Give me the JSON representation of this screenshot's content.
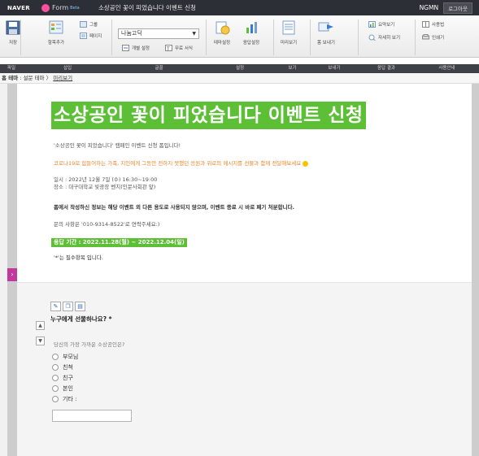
{
  "topbar": {
    "brand": "NAVER",
    "product": "Form",
    "product_badge": "Beta",
    "title": "소상공인 꽃이 피었습니다 이벤트 신청",
    "user_id": "NGMN",
    "logout_label": "로그아웃"
  },
  "ribbon": {
    "save": "저장",
    "add_item": "항목추가",
    "group": "그룹",
    "page": "페이지",
    "font_name": "나눔고딕",
    "open_settings": "개별 설정",
    "copy_format": "무료 서식",
    "design_settings": "테마설정",
    "response_settings": "응답설정",
    "preview": "미리보기",
    "send": "폼 보내기",
    "summary_view": "요약보기",
    "detail_view": "자세히 보기",
    "usage_guide": "사용법",
    "print": "인쇄기"
  },
  "groups": [
    "파일",
    "삽입",
    "글꼴",
    "설정",
    "보기",
    "보내기",
    "응답 결과",
    "사용안내"
  ],
  "breadcrumb": {
    "home": "홈 테마",
    "section": "설문 테마",
    "current": "미리보기"
  },
  "survey": {
    "title": "소상공인 꽃이 피었습니다 이벤트 신청",
    "line1": "'소상공인 꽃이 피었습니다' 캠페인 이벤트 신청 폼입니다!",
    "line2": "코로나19로 힘들어하는 가족, 지인에게 그동안 전하지 못했던 응원과 위로의 메시지를 선물과 함께 전달해보세요",
    "line3": "일시 : 2022년 12월 7일 (수) 16:30~19:00",
    "line4": "장소 : 대구대학교 빛광장 벤치(인문사회관 앞)",
    "line5": "폼에서 작성하신 정보는 해당 이벤트 외 다른 용도로 사용되지 않으며, 이벤트 종료 시 바로 폐기 처분합니다.",
    "line6": "문의 사항은 '010-9314-8522'로 연락주세요:)",
    "period": "응답 기간 : 2022.11.28(월) ~ 2022.12.04(일)",
    "required_note": "'*'는 필수항목 입니다."
  },
  "question": {
    "title": "누구에게 선물하나요? *",
    "description": "당신의 가장 가까운 소상공인은?",
    "options": [
      "부모님",
      "친척",
      "친구",
      "본인",
      "기타 :"
    ]
  },
  "colors": {
    "title_highlight": "#5cbf35",
    "side_tab": "#c2399c",
    "topbar": "#2c2f36"
  }
}
